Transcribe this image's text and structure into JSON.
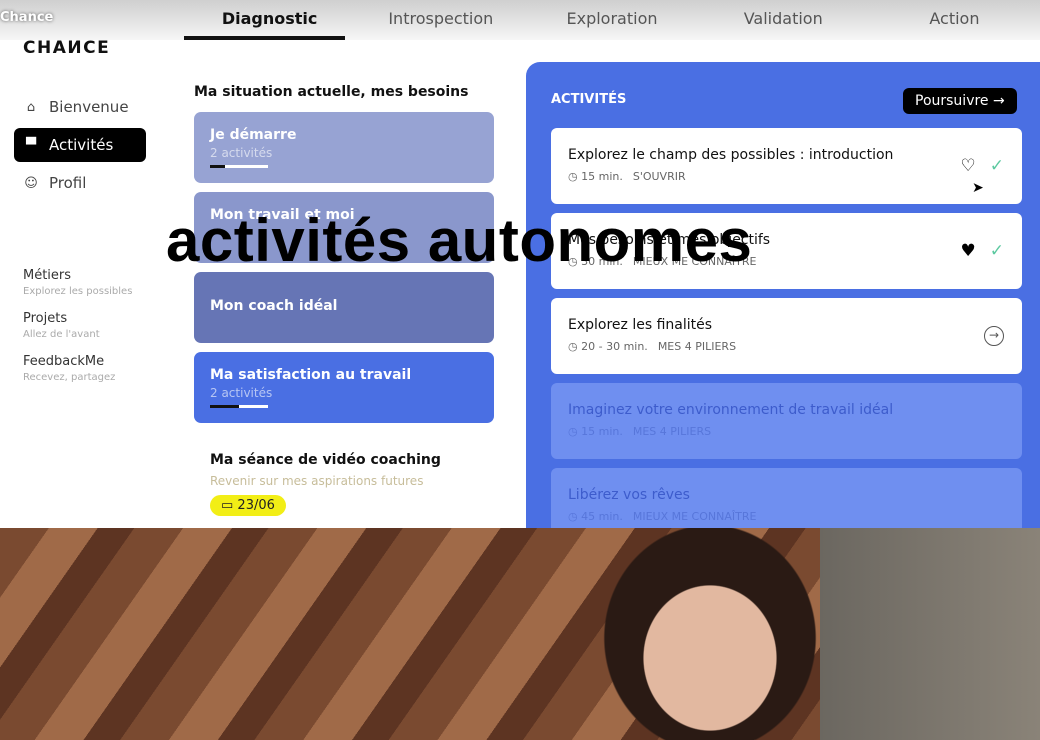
{
  "video_title": "Chance",
  "logo": "CHAИCE",
  "tabs": [
    {
      "label": "Diagnostic",
      "active": true
    },
    {
      "label": "Introspection"
    },
    {
      "label": "Exploration"
    },
    {
      "label": "Validation"
    },
    {
      "label": "Action"
    }
  ],
  "sidebar": {
    "nav": [
      {
        "label": "Bienvenue",
        "icon": "home-icon"
      },
      {
        "label": "Activités",
        "icon": "box-icon",
        "active": true
      },
      {
        "label": "Profil",
        "icon": "user-icon"
      }
    ],
    "sections": [
      {
        "title": "Métiers",
        "subtitle": "Explorez les possibles"
      },
      {
        "title": "Projets",
        "subtitle": "Allez de l'avant"
      },
      {
        "title": "FeedbackMe",
        "subtitle": "Recevez, partagez"
      }
    ]
  },
  "main": {
    "heading": "Ma situation actuelle, mes besoins",
    "cards": [
      {
        "title": "Je démarre",
        "sub": "2 activités",
        "progress": 0.25,
        "color": "#97a3d3"
      },
      {
        "title": "Mon travail et moi",
        "sub": "",
        "color": "#8a97cc"
      },
      {
        "title": "Mon coach idéal",
        "sub": "",
        "color": "#6675b5"
      },
      {
        "title": "Ma satisfaction au travail",
        "sub": "2 activités",
        "progress": 0.5,
        "color": "#4a6fe3"
      }
    ],
    "session": {
      "title": "Ma séance de vidéo coaching",
      "sub": "Revenir sur mes aspirations futures",
      "date": "23/06"
    }
  },
  "panel": {
    "title": "ACTIVITÉS",
    "button": "Poursuivre",
    "activities": [
      {
        "title": "Explorez le champ des possibles : introduction",
        "duration": "15 min.",
        "tag": "S'OUVRIR",
        "state": "liked-outline"
      },
      {
        "title": "Mes besoins et mes objectifs",
        "duration": "30 min.",
        "tag": "MIEUX ME CONNAÎTRE",
        "state": "liked"
      },
      {
        "title": "Explorez les finalités",
        "duration": "20 - 30 min.",
        "tag": "MES 4 PILIERS",
        "state": "next"
      },
      {
        "title": "Imaginez votre environnement de travail idéal",
        "duration": "15 min.",
        "tag": "MES 4 PILIERS",
        "state": "locked"
      },
      {
        "title": "Libérez vos rêves",
        "duration": "45 min.",
        "tag": "MIEUX ME CONNAÎTRE",
        "state": "locked"
      }
    ]
  },
  "caption": "activités autonomes"
}
